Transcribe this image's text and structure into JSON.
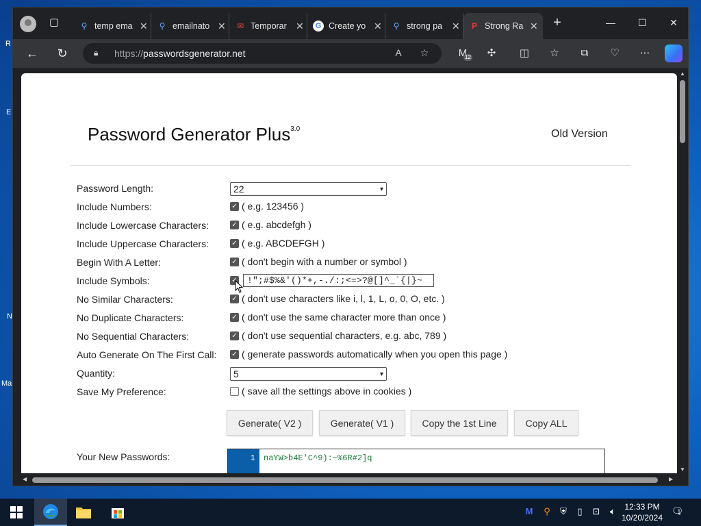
{
  "browser": {
    "tabs": [
      {
        "title": "temp ema",
        "icon": "search-icon"
      },
      {
        "title": "emailnato",
        "icon": "search-icon"
      },
      {
        "title": "Temporar",
        "icon": "mail-icon"
      },
      {
        "title": "Create yo",
        "icon": "google-icon"
      },
      {
        "title": "strong pa",
        "icon": "search-icon"
      },
      {
        "title": "Strong Ra",
        "icon": "site-icon",
        "active": true
      }
    ],
    "url_protocol": "https://",
    "url_host": "passwordsgenerator.net",
    "extension_badge": "12"
  },
  "page": {
    "title": "Password Generator Plus",
    "version": "3.0",
    "old_version_link": "Old Version",
    "rows": [
      {
        "label": "Password Length:",
        "type": "select",
        "value": "22"
      },
      {
        "label": "Include Numbers:",
        "type": "checkbox",
        "checked": true,
        "hint": "( e.g. 123456 )"
      },
      {
        "label": "Include Lowercase Characters:",
        "type": "checkbox",
        "checked": true,
        "hint": "( e.g. abcdefgh )"
      },
      {
        "label": "Include Uppercase Characters:",
        "type": "checkbox",
        "checked": true,
        "hint": "( e.g. ABCDEFGH )"
      },
      {
        "label": "Begin With A Letter:",
        "type": "checkbox",
        "checked": true,
        "hint": "( don't begin with a number or symbol )"
      },
      {
        "label": "Include Symbols:",
        "type": "checkbox-input",
        "checked": true,
        "value": "!\";#$%&'()*+,-./:;<=>?@[]^_`{|}~"
      },
      {
        "label": "No Similar Characters:",
        "type": "checkbox",
        "checked": true,
        "hint": "( don't use characters like i, l, 1, L, o, 0, O, etc. )"
      },
      {
        "label": "No Duplicate Characters:",
        "type": "checkbox",
        "checked": true,
        "hint": "( don't use the same character more than once )"
      },
      {
        "label": "No Sequential Characters:",
        "type": "checkbox",
        "checked": true,
        "hint": "( don't use sequential characters, e.g. abc, 789 )"
      },
      {
        "label": "Auto Generate On The First Call:",
        "type": "checkbox",
        "checked": true,
        "hint": "( generate passwords automatically when you open this page )"
      },
      {
        "label": "Quantity:",
        "type": "select",
        "value": "5"
      },
      {
        "label": "Save My Preference:",
        "type": "checkbox",
        "checked": false,
        "hint": "( save all the settings above in cookies )"
      }
    ],
    "buttons": [
      "Generate( V2 )",
      "Generate( V1 )",
      "Copy the 1st Line",
      "Copy ALL"
    ],
    "result_label": "Your New Passwords:",
    "result_line_number": "1",
    "result_first_password": "naYW>b4E'C^9):~%6R#2]q"
  },
  "taskbar": {
    "time": "12:33 PM",
    "date": "10/20/2024",
    "notification_count": "1"
  },
  "desktop_stubs": [
    "R",
    "E",
    "N",
    "Ma"
  ],
  "colors": {
    "accent": "#0b5ea8",
    "password_text": "#1a7a3a"
  }
}
